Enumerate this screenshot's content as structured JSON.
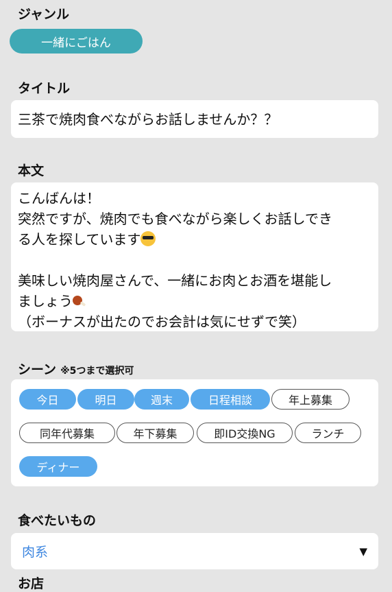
{
  "genre": {
    "label": "ジャンル",
    "value": "一緒にごはん"
  },
  "title": {
    "label": "タイトル",
    "value": "三茶で焼肉食べながらお話しませんか？？"
  },
  "body": {
    "label": "本文",
    "lines": [
      "こんばんは！",
      "突然ですが、焼肉でも食べながら楽しくお話しでき",
      "る人を探しています",
      "",
      "美味しい焼肉屋さんで、一緒にお肉とお酒を堪能し",
      "ましょう",
      "（ボーナスが出たのでお会計は気にせずで笑）"
    ]
  },
  "scene": {
    "label": "シーン",
    "note": "※5つまで選択可",
    "chips": [
      {
        "label": "今日",
        "selected": true
      },
      {
        "label": "明日",
        "selected": true
      },
      {
        "label": "週末",
        "selected": true
      },
      {
        "label": "日程相談",
        "selected": true
      },
      {
        "label": "年上募集",
        "selected": false
      },
      {
        "label": "同年代募集",
        "selected": false
      },
      {
        "label": "年下募集",
        "selected": false
      },
      {
        "label": "即ID交換NG",
        "selected": false
      },
      {
        "label": "ランチ",
        "selected": false
      },
      {
        "label": "ディナー",
        "selected": true
      }
    ]
  },
  "food": {
    "label": "食べたいもの",
    "value": "肉系"
  },
  "shop": {
    "label": "お店"
  },
  "colors": {
    "accent_teal": "#3fa9b5",
    "chip_selected": "#58a9ec",
    "select_value": "#3d86e0"
  }
}
